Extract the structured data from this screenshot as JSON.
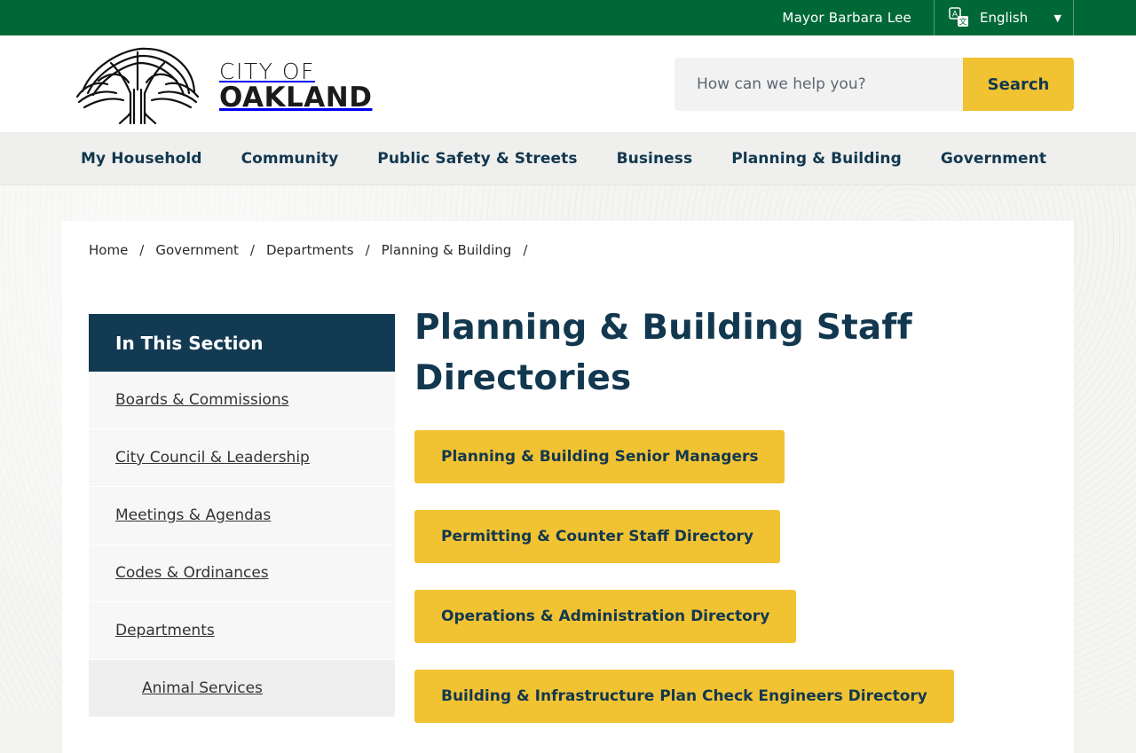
{
  "topbar": {
    "mayor_link": "Mayor Barbara Lee",
    "language_label": "English"
  },
  "header": {
    "logo_line1": "CITY OF",
    "logo_line2": "OAKLAND",
    "search_placeholder": "How can we help you?",
    "search_button": "Search"
  },
  "nav": {
    "items": [
      "My Household",
      "Community",
      "Public Safety & Streets",
      "Business",
      "Planning & Building",
      "Government"
    ]
  },
  "breadcrumb": {
    "items": [
      "Home",
      "Government",
      "Departments",
      "Planning & Building"
    ],
    "separator": "/"
  },
  "sidebar": {
    "heading": "In This Section",
    "items": [
      "Boards & Commissions",
      "City Council & Leadership",
      "Meetings & Agendas",
      "Codes & Ordinances",
      "Departments"
    ],
    "subitems": [
      "Animal Services"
    ]
  },
  "main": {
    "title": "Planning & Building Staff Directories",
    "buttons": [
      "Planning & Building Senior Managers",
      "Permitting & Counter Staff Directory",
      "Operations & Administration Directory",
      "Building & Infrastructure Plan Check Engineers Directory"
    ]
  },
  "colors": {
    "topbar_green": "#006837",
    "accent_yellow": "#f1c232",
    "navy": "#12384f"
  }
}
